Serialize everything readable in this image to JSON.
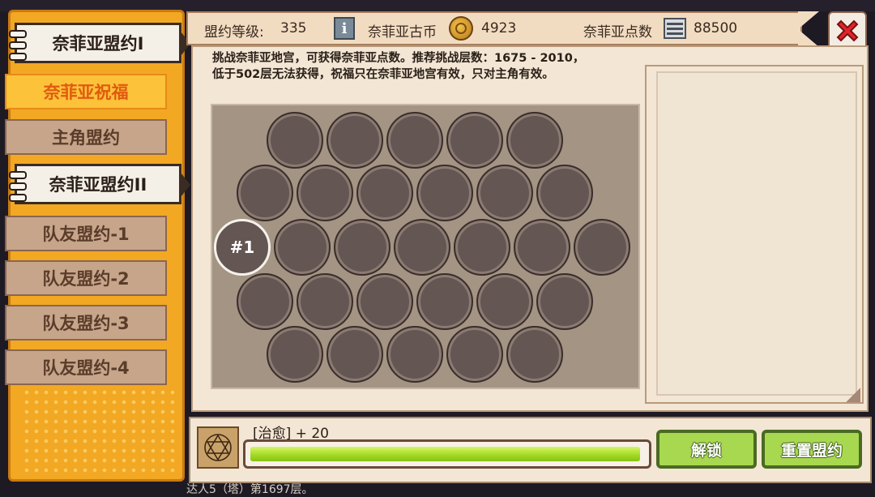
{
  "sidebar": {
    "items": [
      {
        "label": "奈菲亚盟约I",
        "style": "major"
      },
      {
        "label": "奈菲亚祝福",
        "style": "selected"
      },
      {
        "label": "主角盟约",
        "style": "tab"
      },
      {
        "label": "奈菲亚盟约II",
        "style": "major"
      },
      {
        "label": "队友盟约-1",
        "style": "tab"
      },
      {
        "label": "队友盟约-2",
        "style": "tab"
      },
      {
        "label": "队友盟约-3",
        "style": "tab"
      },
      {
        "label": "队友盟约-4",
        "style": "tab"
      }
    ]
  },
  "header": {
    "level_label": "盟约等级:",
    "level_value": "335",
    "info_icon": "info-icon",
    "coin_label": "奈菲亚古币",
    "coin_value": "4923",
    "coin_icon": "gold-coin-icon",
    "points_label": "奈菲亚点数",
    "points_value": "88500",
    "points_icon": "ticket-icon",
    "close_icon": "red-x-icon"
  },
  "description": {
    "line1": "挑战奈菲亚地宫，可获得奈菲亚点数。推荐挑战层数：1675 - 2010，",
    "line2": "低于502层无法获得，祝福只在奈菲亚地宫有效，只对主角有效。"
  },
  "grid": {
    "rows": [
      5,
      6,
      7,
      6,
      5
    ],
    "unlocked_label": "#1"
  },
  "bottom": {
    "bonus_text": "[治愈] + 20",
    "progress": 0.99,
    "unlock_button": "解锁",
    "reset_button": "重置盟约"
  },
  "background_text": "达人5（塔）第1697层。",
  "colors": {
    "sidebar": "#f2a823",
    "panel": "#f3e6d4",
    "cell": "#645652",
    "button": "#a8d850",
    "close": "#e0242a"
  }
}
